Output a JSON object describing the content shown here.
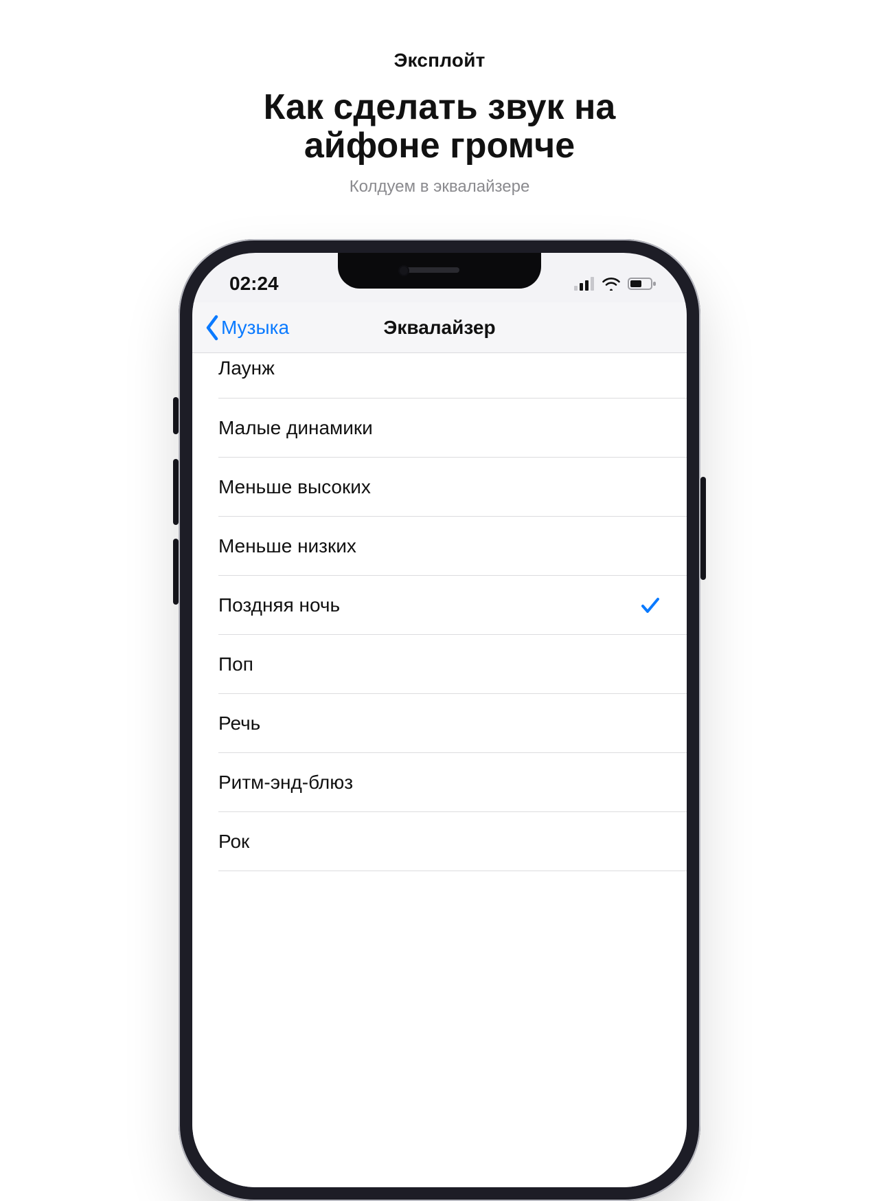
{
  "header": {
    "brand": "Эксплойт",
    "headline_l1": "Как сделать звук на",
    "headline_l2": "айфоне громче",
    "subhead": "Колдуем в эквалайзере"
  },
  "phone": {
    "status": {
      "time": "02:24"
    },
    "nav": {
      "back": "Музыка",
      "title": "Эквалайзер"
    },
    "eq": {
      "items": [
        {
          "label": "Лаунж",
          "selected": false
        },
        {
          "label": "Малые динамики",
          "selected": false
        },
        {
          "label": "Меньше высоких",
          "selected": false
        },
        {
          "label": "Меньше низких",
          "selected": false
        },
        {
          "label": "Поздняя ночь",
          "selected": true
        },
        {
          "label": "Поп",
          "selected": false
        },
        {
          "label": "Речь",
          "selected": false
        },
        {
          "label": "Ритм-энд-блюз",
          "selected": false
        },
        {
          "label": "Рок",
          "selected": false
        }
      ]
    }
  }
}
